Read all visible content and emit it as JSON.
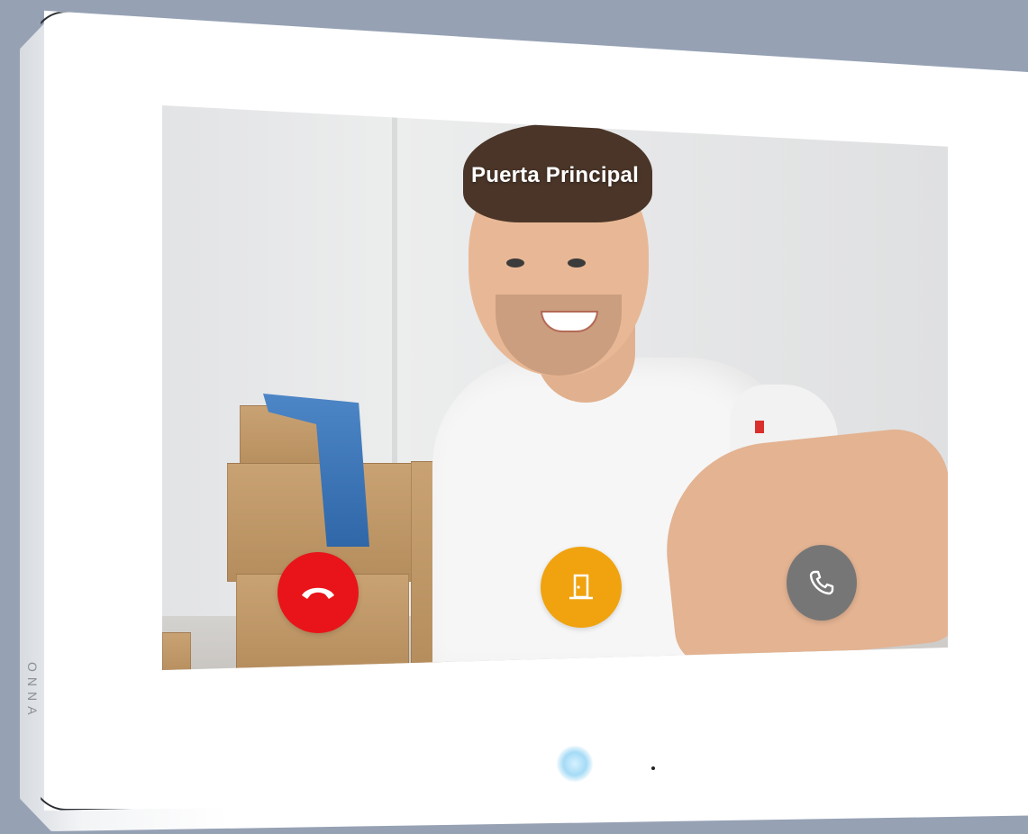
{
  "device": {
    "brand": "ONNA"
  },
  "screen": {
    "caller_name": "Puerta Principal",
    "actions": [
      {
        "id": "hangup",
        "icon": "phone-hangup-icon",
        "color": "#e8141a"
      },
      {
        "id": "open-door",
        "icon": "door-open-icon",
        "color": "#f0a30f"
      },
      {
        "id": "answer",
        "icon": "phone-answer-icon",
        "color": "#767676"
      }
    ]
  }
}
